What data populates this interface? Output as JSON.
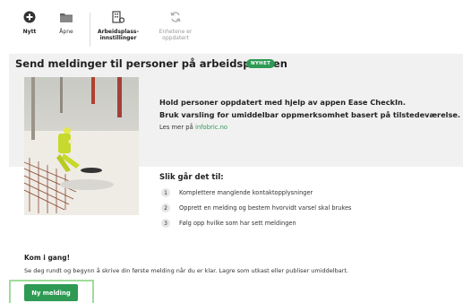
{
  "toolbar": {
    "new_label": "Nytt",
    "open_label": "Åpne",
    "workplace_settings_label_1": "Arbeidsplass-",
    "workplace_settings_label_2": "innstillinger",
    "update_units_label_1": "Enhetene er",
    "update_units_label_2": "oppdatert"
  },
  "banner": {
    "title": "Send meldinger til personer på arbeidsplassen",
    "badge": "NYHET",
    "info_line1": "Hold personer oppdatert med hjelp av appen Ease CheckIn.",
    "info_line2": "Bruk varsling for umiddelbar oppmerksomhet basert på tilstedeværelse.",
    "read_more_prefix": "Les mer på",
    "read_more_link": "infobric.no"
  },
  "how": {
    "title": "Slik går det til:",
    "steps": [
      {
        "num": "1",
        "text": "Komplettere manglende kontaktopplysninger"
      },
      {
        "num": "2",
        "text": "Opprett en melding og bestem hvorvidt varsel skal brukes"
      },
      {
        "num": "3",
        "text": "Følg opp hvilke som har sett meldingen"
      }
    ]
  },
  "start": {
    "title": "Kom i gang!",
    "text": "Se deg rundt og begynn å skrive din første melding når du er klar. Lagre som utkast eller publiser umiddelbart.",
    "new_message_button": "Ny melding"
  },
  "colors": {
    "accent_green": "#2e9a54",
    "banner_gray": "#f1f1f1",
    "focus_outline": "#9fdd9a"
  },
  "icons": {
    "new": "plus-circle-icon",
    "open": "folder-icon",
    "workplace_settings": "building-settings-icon",
    "update_units": "sync-icon"
  }
}
